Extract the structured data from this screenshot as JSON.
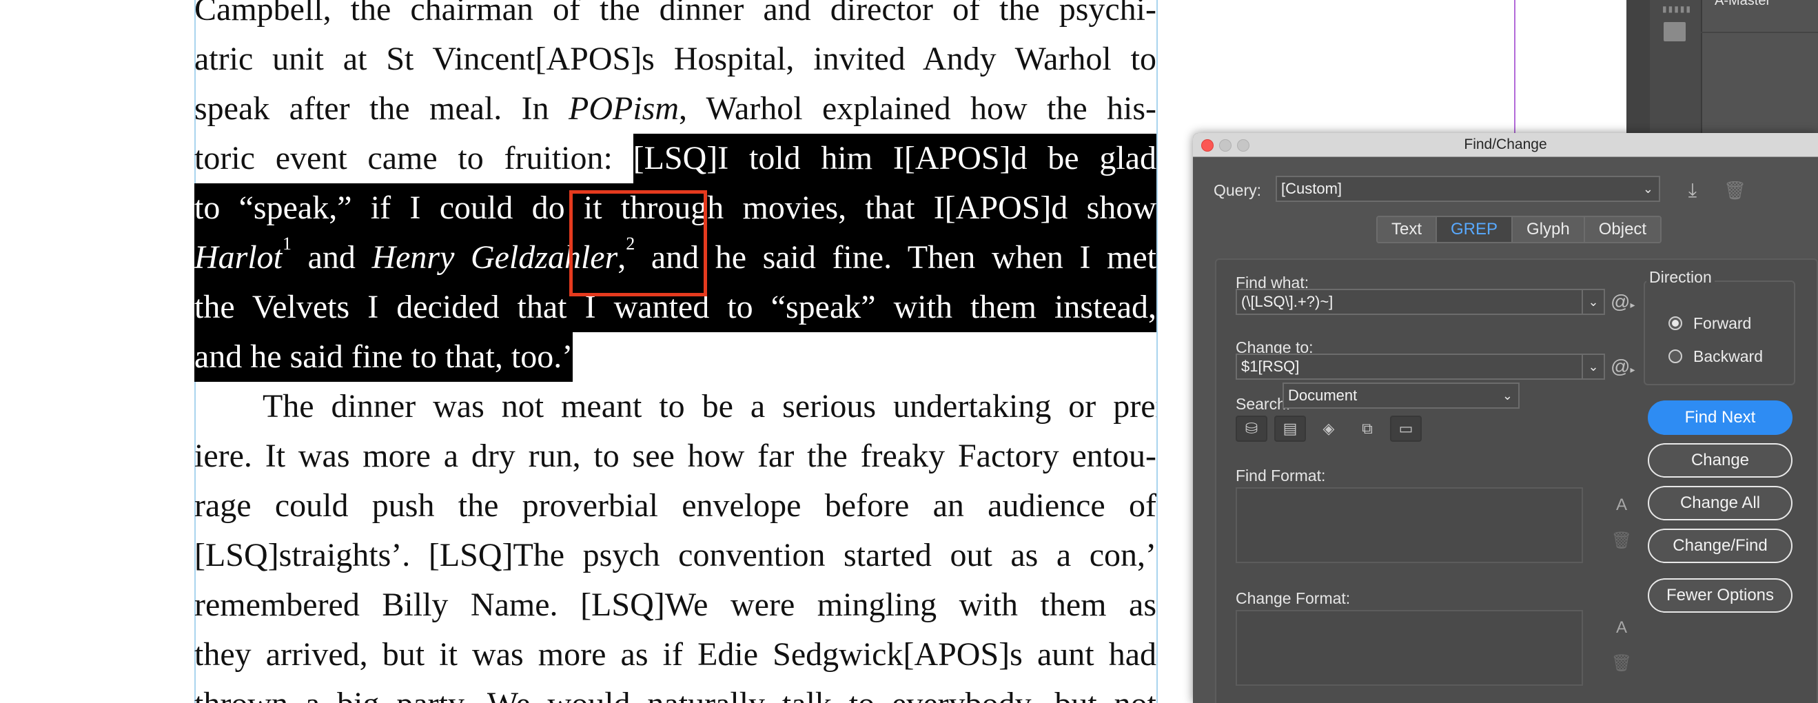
{
  "document": {
    "lines": [
      [
        {
          "t": "Campbell, the chairman of the dinner and director of the psychi-"
        }
      ],
      [
        {
          "t": "atric unit at St Vincent[APOS]s Hospital, invited Andy Warhol to"
        }
      ],
      [
        {
          "t": "speak after the meal. In "
        },
        {
          "t": "POPism",
          "i": true
        },
        {
          "t": ", Warhol explained how the his-"
        }
      ],
      [
        {
          "t": "toric event came to fruition: "
        },
        {
          "t": "[LSQ]I told him I[APOS]d be glad",
          "s": true
        }
      ],
      [
        {
          "t": "to “speak,” if I could do it through movies, that I[APOS]d show",
          "s": true
        }
      ],
      [
        {
          "t": "Harlot",
          "i": true,
          "s": true
        },
        {
          "t": "1",
          "sup": true,
          "s": true
        },
        {
          "t": " and ",
          "s": true
        },
        {
          "t": "Henry Geldzahler",
          "i": true,
          "s": true
        },
        {
          "t": ",",
          "s": true
        },
        {
          "t": "2",
          "sup": true,
          "s": true
        },
        {
          "t": " and he said fine. Then when I met",
          "s": true
        }
      ],
      [
        {
          "t": "the Velvets I decided that I wanted to “speak” with them instead,",
          "s": true
        }
      ],
      [
        {
          "t": "and he said fine to that, too.’",
          "s": true
        }
      ],
      [
        {
          "t": "    The dinner was not meant to be a serious undertaking or prem-"
        }
      ],
      [
        {
          "t": "iere. It was more a dry run, to see how far the freaky Factory entou-"
        }
      ],
      [
        {
          "t": "rage could push the proverbial envelope before an audience of"
        }
      ],
      [
        {
          "t": "[LSQ]straights’. [LSQ]The psych convention started out as a con,’"
        }
      ],
      [
        {
          "t": "remembered Billy Name. [LSQ]We were mingling with them as"
        }
      ],
      [
        {
          "t": "they arrived, but it was more as if Edie Sedgwick[APOS]s aunt had"
        }
      ],
      [
        {
          "t": "thrown a big party. We would naturally talk to everybody, but not"
        }
      ]
    ]
  },
  "pages_panel": {
    "master_label": "A-Master"
  },
  "dialog": {
    "title": "Find/Change",
    "query_label": "Query:",
    "query_value": "[Custom]",
    "tabs": [
      {
        "label": "Text",
        "active": false
      },
      {
        "label": "GREP",
        "active": true
      },
      {
        "label": "Glyph",
        "active": false
      },
      {
        "label": "Object",
        "active": false
      }
    ],
    "find_what_label": "Find what:",
    "find_what_value": "(\\[LSQ\\].+?)~]",
    "change_to_label": "Change to:",
    "change_to_value": "$1[RSQ]",
    "search_label": "Search:",
    "search_value": "Document",
    "find_format_label": "Find Format:",
    "change_format_label": "Change Format:",
    "direction_label": "Direction",
    "forward_label": "Forward",
    "backward_label": "Backward",
    "direction_selected": "forward",
    "buttons": {
      "find_next": "Find Next",
      "change": "Change",
      "change_all": "Change All",
      "change_find": "Change/Find",
      "fewer_options": "Fewer Options"
    },
    "colors": {
      "accent": "#2e8cf3",
      "active_tab_text": "#58a9ff",
      "close_button": "#fc5753"
    }
  }
}
